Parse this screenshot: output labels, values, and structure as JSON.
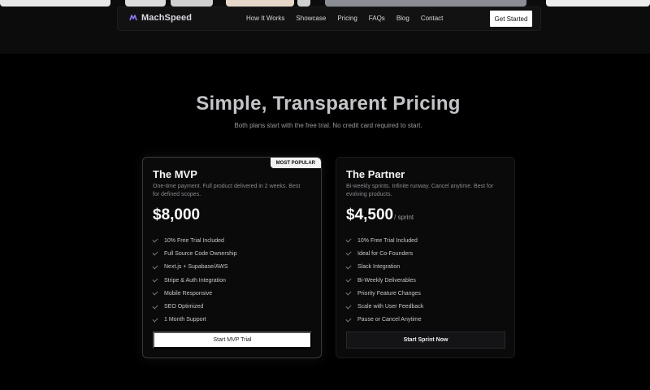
{
  "nav": {
    "brand": "MachSpeed",
    "links": [
      "How It Works",
      "Showcase",
      "Pricing",
      "FAQs",
      "Blog",
      "Contact"
    ],
    "cta": "Get Started"
  },
  "hero": {
    "title": "Simple, Transparent Pricing",
    "subtitle": "Both plans start with the free trial. No credit card required to start."
  },
  "plans": [
    {
      "badge": "MOST POPULAR",
      "name": "The MVP",
      "description": "One-time payment. Full product delivered in 2 weeks. Best for defined scopes.",
      "price": "$8,000",
      "price_suffix": "",
      "features": [
        "10% Free Trial Included",
        "Full Source Code Ownership",
        "Next.js + Supabase/AWS",
        "Stripe & Auth Integration",
        "Mobile Responsive",
        "SEO Optimized",
        "1 Month Support"
      ],
      "button": "Start MVP Trial"
    },
    {
      "name": "The Partner",
      "description": "Bi-weekly sprints. Infinite runway. Cancel anytime. Best for evolving products.",
      "price": "$4,500",
      "price_suffix": "/ sprint",
      "features": [
        "10% Free Trial Included",
        "Ideal for Co-Founders",
        "Slack Integration",
        "Bi-Weekly Deliverables",
        "Priority Feature Changes",
        "Scale with User Feedback",
        "Pause or Cancel Anytime"
      ],
      "button": "Start Sprint Now"
    }
  ],
  "colors": {
    "background": "#000000",
    "accent_brand": "#8b7cf6",
    "check": "#7d7d84"
  }
}
